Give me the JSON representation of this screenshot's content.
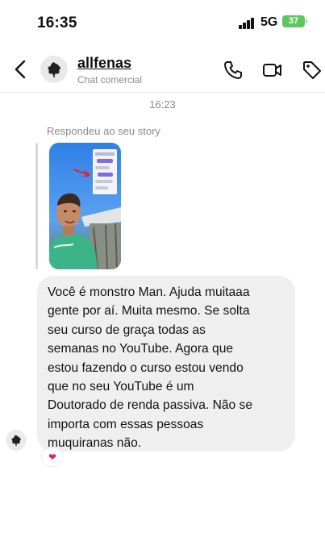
{
  "status_bar": {
    "time": "16:35",
    "network": "5G",
    "battery": "37"
  },
  "header": {
    "name": "allfenas",
    "subtitle": "Chat comercial"
  },
  "icons": [
    "back-arrow-icon",
    "avatar-logo-icon",
    "phone-icon",
    "video-icon",
    "tag-icon",
    "heart-icon"
  ],
  "chat": {
    "timestamp": "16:23",
    "reply_label": "Respondeu ao seu story",
    "message": "Você é monstro Man. Ajuda muitaaa\ngente por aí. Muita mesmo. Se solta\nseu curso de graça todas as\nsemanas no YouTube. Agora que\nestou fazendo o curso estou vendo\nque no seu YouTube é um\nDoutorado de renda passiva. Não se\nimporta com essas pessoas\nmuquiranas não.",
    "reaction": "❤"
  },
  "colors": {
    "bubble": "#efefef",
    "battery": "#5cc85b",
    "muted": "#8a8a8a"
  }
}
